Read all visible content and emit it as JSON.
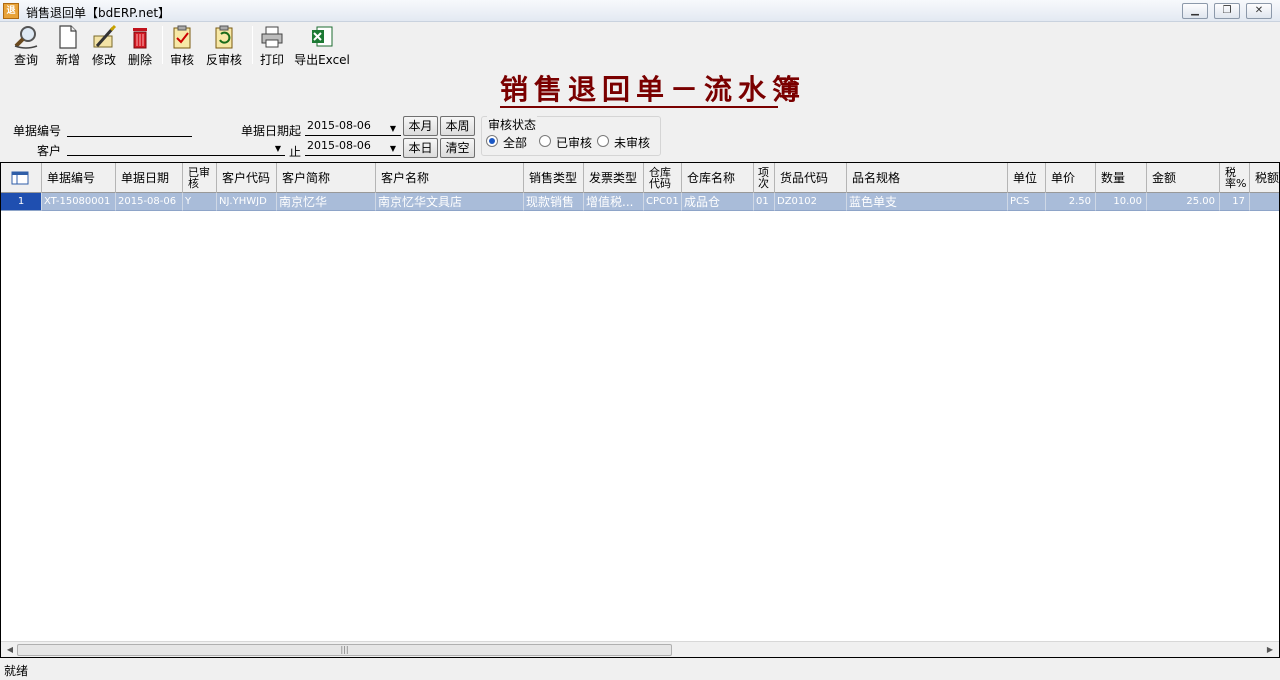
{
  "window": {
    "title": "销售退回单【bdERP.net】",
    "app_icon_text": "退"
  },
  "toolbar": {
    "query": "查询",
    "add": "新增",
    "edit": "修改",
    "delete": "删除",
    "approve": "审核",
    "unapprove": "反审核",
    "print": "打印",
    "export": "导出Excel"
  },
  "heading": "销售退回单－流水簿",
  "filter": {
    "doc_no_label": "单据编号",
    "customer_label": "客户",
    "date_from_label": "单据日期起",
    "date_to_label": "止",
    "date_from": "2015-08-06",
    "date_to": "2015-08-06",
    "this_month": "本月",
    "this_week": "本周",
    "today": "本日",
    "clear": "清空",
    "audit_title": "审核状态",
    "audit_all": "全部",
    "audit_done": "已审核",
    "audit_not": "未审核"
  },
  "grid": {
    "headers": {
      "doc_no": "单据编号",
      "doc_date": "单据日期",
      "approved": "已审核",
      "cust_code": "客户代码",
      "cust_short": "客户简称",
      "cust_name": "客户名称",
      "sale_type": "销售类型",
      "invoice_type": "发票类型",
      "wh_code": "仓库代码",
      "wh_name": "仓库名称",
      "item_no": "项次",
      "goods_code": "货品代码",
      "spec": "品名规格",
      "unit": "单位",
      "price": "单价",
      "qty": "数量",
      "amount": "金额",
      "tax_rate": "税率%",
      "tax": "税额"
    },
    "rows": [
      {
        "idx": "1",
        "doc_no": "XT-15080001",
        "doc_date": "2015-08-06",
        "approved": "Y",
        "cust_code": "NJ.YHWJD",
        "cust_short": "南京忆华",
        "cust_name": "南京忆华文具店",
        "sale_type": "现款销售",
        "invoice_type": "增值税...",
        "wh_code": "CPC01",
        "wh_name": "成品仓",
        "item_no": "01",
        "goods_code": "DZ0102",
        "spec": "蓝色单支",
        "unit": "PCS",
        "price": "2.50",
        "qty": "10.00",
        "amount": "25.00",
        "tax_rate": "17",
        "tax": ""
      }
    ]
  },
  "status": "就绪"
}
